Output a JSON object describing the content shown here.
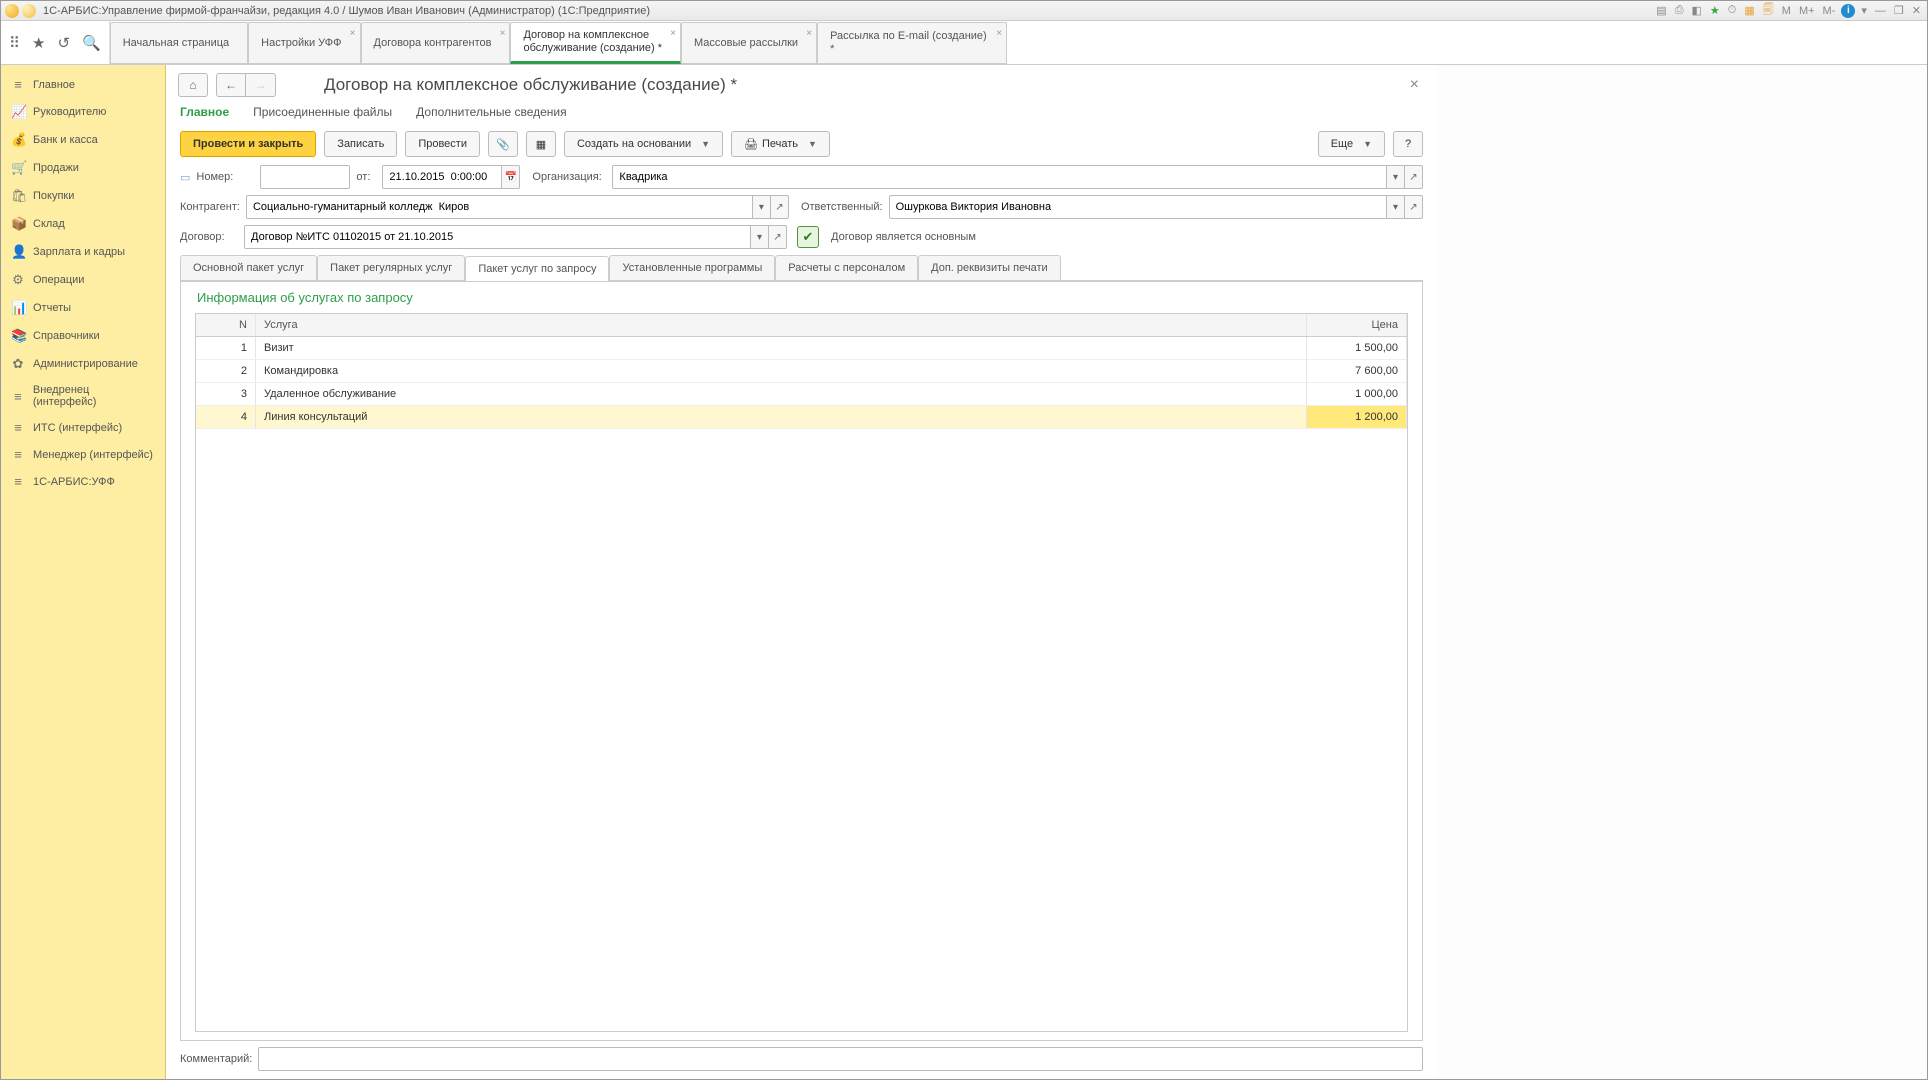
{
  "window": {
    "title": "1С-АРБИС:Управление фирмой-франчайзи, редакция 4.0 / Шумов Иван Иванович (Администратор)  (1С:Предприятие)",
    "sys_icons": [
      "M",
      "M+",
      "M-"
    ]
  },
  "top_tabs": [
    {
      "label": "Начальная страница",
      "closable": false
    },
    {
      "label": "Настройки УФФ",
      "closable": true
    },
    {
      "label": "Договора контрагентов",
      "closable": true
    },
    {
      "label": "Договор на комплексное обслуживание (создание) *",
      "closable": true,
      "active": true,
      "multiline": true
    },
    {
      "label": "Массовые рассылки",
      "closable": true
    },
    {
      "label": "Рассылка по E-mail (создание) *",
      "closable": true
    }
  ],
  "leftnav": [
    {
      "icon": "≡",
      "label": "Главное"
    },
    {
      "icon": "📈",
      "label": "Руководителю"
    },
    {
      "icon": "💰",
      "label": "Банк и касса"
    },
    {
      "icon": "🛒",
      "label": "Продажи"
    },
    {
      "icon": "🛍",
      "label": "Покупки"
    },
    {
      "icon": "📦",
      "label": "Склад"
    },
    {
      "icon": "👤",
      "label": "Зарплата и кадры"
    },
    {
      "icon": "⚙",
      "label": "Операции"
    },
    {
      "icon": "📊",
      "label": "Отчеты"
    },
    {
      "icon": "📚",
      "label": "Справочники"
    },
    {
      "icon": "✿",
      "label": "Администрирование"
    },
    {
      "icon": "≡",
      "label": "Внедренец (интерфейс)"
    },
    {
      "icon": "≡",
      "label": "ИТС (интерфейс)"
    },
    {
      "icon": "≡",
      "label": "Менеджер (интерфейс)"
    },
    {
      "icon": "≡",
      "label": "1С-АРБИС:УФФ"
    }
  ],
  "page": {
    "title": "Договор на комплексное обслуживание (создание) *",
    "subtabs": [
      {
        "label": "Главное",
        "active": true
      },
      {
        "label": "Присоединенные файлы"
      },
      {
        "label": "Дополнительные сведения"
      }
    ],
    "toolbar": {
      "post_close": "Провести и закрыть",
      "save": "Записать",
      "post": "Провести",
      "create_based": "Создать на основании",
      "print": "Печать",
      "more": "Еще",
      "help": "?"
    },
    "form": {
      "number_label": "Номер:",
      "number_value": "",
      "from_label": "от:",
      "date_value": "21.10.2015  0:00:00",
      "org_label": "Организация:",
      "org_value": "Квадрика",
      "contragent_label": "Контрагент:",
      "contragent_value": "Социально-гуманитарный колледж  Киров",
      "responsible_label": "Ответственный:",
      "responsible_value": "Ошуркова Виктория Ивановна",
      "contract_label": "Договор:",
      "contract_value": "Договор №ИТС 01102015 от 21.10.2015",
      "main_contract_label": "Договор является основным",
      "comment_label": "Комментарий:",
      "comment_value": ""
    },
    "inner_tabs": [
      {
        "label": "Основной пакет услуг"
      },
      {
        "label": "Пакет регулярных услуг"
      },
      {
        "label": "Пакет услуг по запросу",
        "active": true
      },
      {
        "label": "Установленные программы"
      },
      {
        "label": "Расчеты с персоналом"
      },
      {
        "label": "Доп. реквизиты печати"
      }
    ],
    "section_title": "Информация об услугах по запросу",
    "table": {
      "columns": {
        "n": "N",
        "service": "Услуга",
        "price": "Цена"
      },
      "rows": [
        {
          "n": "1",
          "service": "Визит",
          "price": "1 500,00"
        },
        {
          "n": "2",
          "service": "Командировка",
          "price": "7 600,00"
        },
        {
          "n": "3",
          "service": "Удаленное обслуживание",
          "price": "1 000,00"
        },
        {
          "n": "4",
          "service": "Линия консультаций",
          "price": "1 200,00",
          "selected": true
        }
      ]
    }
  }
}
